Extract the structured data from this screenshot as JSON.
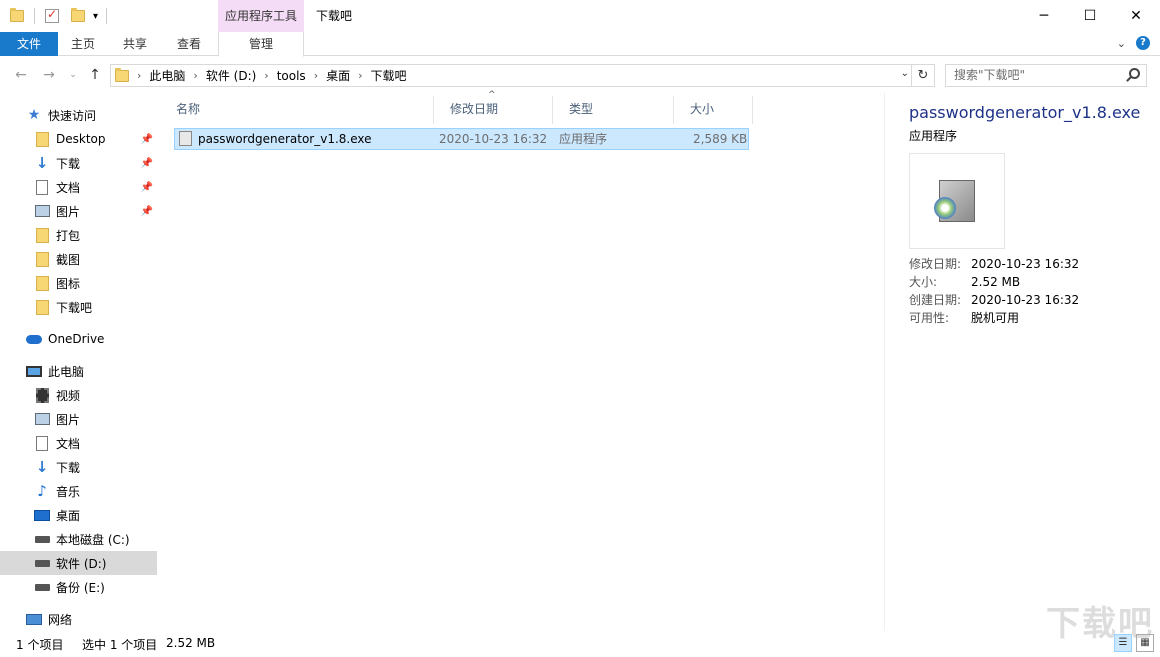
{
  "window": {
    "title": "下载吧",
    "context_tab": "应用程序工具",
    "controls": {
      "minimize": "─",
      "maximize": "☐",
      "close": "✕"
    }
  },
  "ribbon": {
    "tabs": [
      "文件",
      "主页",
      "共享",
      "查看",
      "管理"
    ]
  },
  "address": {
    "crumbs": [
      "此电脑",
      "软件 (D:)",
      "tools",
      "桌面",
      "下载吧"
    ],
    "search_placeholder": "搜索\"下载吧\""
  },
  "sidebar": {
    "quick_access": "快速访问",
    "quick_items": [
      "Desktop",
      "下载",
      "文档",
      "图片",
      "打包",
      "截图",
      "图标",
      "下载吧"
    ],
    "onedrive": "OneDrive",
    "this_pc": "此电脑",
    "pc_items": [
      "视频",
      "图片",
      "文档",
      "下载",
      "音乐",
      "桌面",
      "本地磁盘 (C:)",
      "软件 (D:)",
      "备份 (E:)"
    ],
    "network": "网络"
  },
  "columns": {
    "name": "名称",
    "date": "修改日期",
    "type": "类型",
    "size": "大小"
  },
  "files": [
    {
      "name": "passwordgenerator_v1.8.exe",
      "date": "2020-10-23 16:32",
      "type": "应用程序",
      "size": "2,589 KB"
    }
  ],
  "preview": {
    "filename": "passwordgenerator_v1.8.exe",
    "filetype": "应用程序",
    "meta": [
      {
        "key": "修改日期:",
        "value": "2020-10-23 16:32"
      },
      {
        "key": "大小:",
        "value": "2.52 MB"
      },
      {
        "key": "创建日期:",
        "value": "2020-10-23 16:32"
      },
      {
        "key": "可用性:",
        "value": "脱机可用"
      }
    ]
  },
  "status": {
    "count": "1 个项目",
    "selected": "选中 1 个项目",
    "size": "2.52 MB"
  },
  "watermark": "下载吧",
  "colors": {
    "file_tab": "#1979ca",
    "context_tab": "#f5dcf6",
    "selection": "#cce8ff",
    "sidebar_selected": "#d9d9d9"
  }
}
